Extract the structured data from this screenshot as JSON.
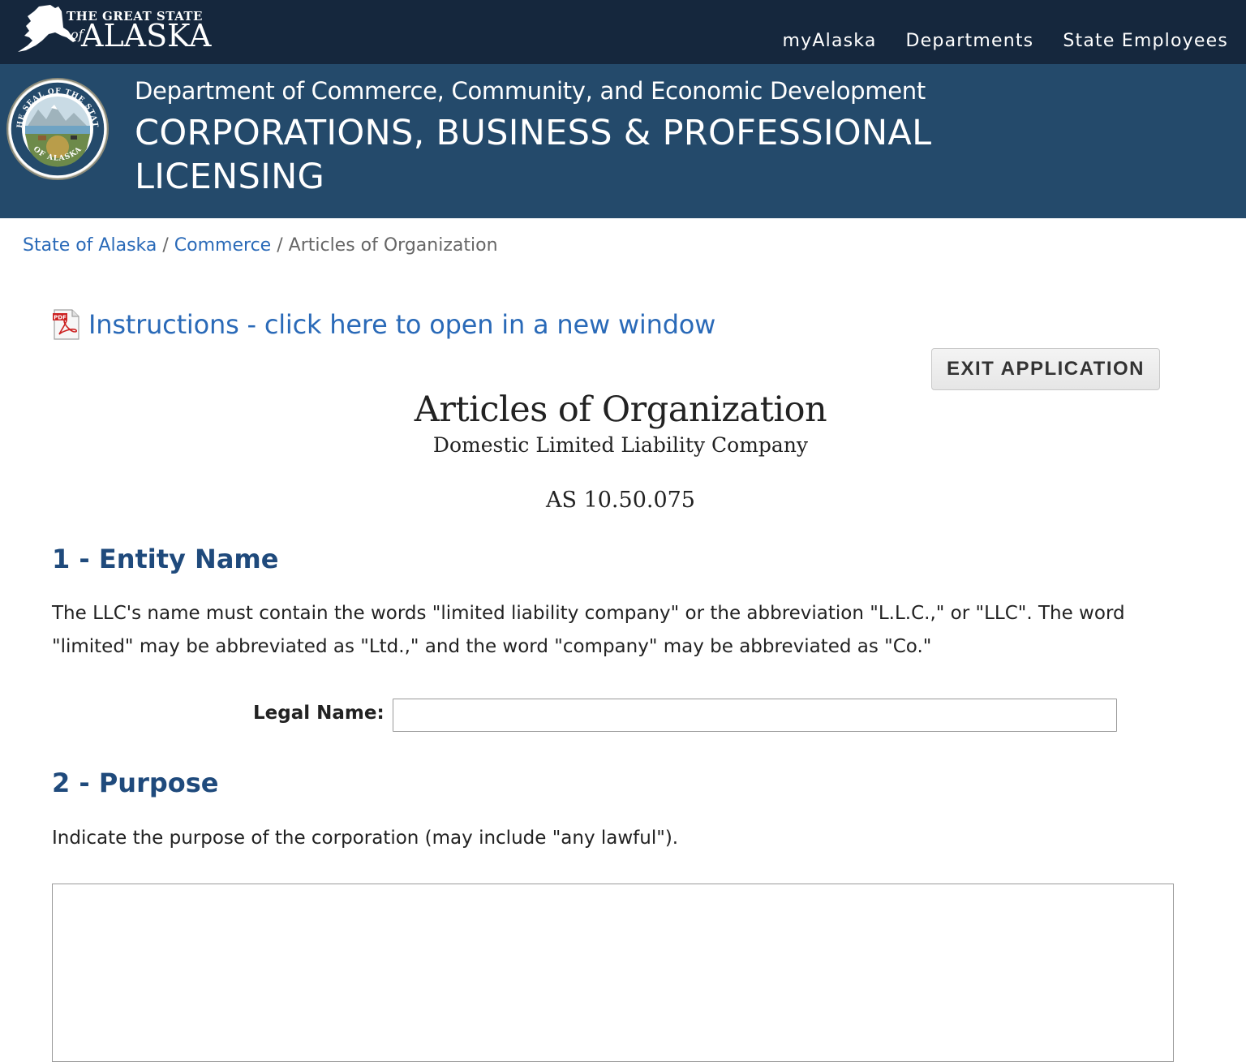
{
  "header": {
    "logo_top": "THE GREAT STATE",
    "logo_of": "of",
    "logo_state": "ALASKA",
    "nav": [
      {
        "label": "myAlaska"
      },
      {
        "label": "Departments"
      },
      {
        "label": "State Employees"
      }
    ]
  },
  "banner": {
    "department": "Department of Commerce, Community, and Economic Development",
    "division": "CORPORATIONS, BUSINESS & PROFESSIONAL LICENSING",
    "seal_text_top": "THE SEAL OF THE STATE",
    "seal_text_bottom": "OF ALASKA"
  },
  "breadcrumb": {
    "items": [
      {
        "label": "State of Alaska"
      },
      {
        "label": "Commerce"
      },
      {
        "label": "Articles of Organization"
      }
    ],
    "separator": "/"
  },
  "instructions": {
    "icon": "pdf-icon",
    "label": "Instructions - click here to open in a new window"
  },
  "exit_button": {
    "label": "EXIT APPLICATION"
  },
  "form": {
    "title": "Articles of Organization",
    "subtitle": "Domestic Limited Liability Company",
    "statute": "AS 10.50.075"
  },
  "sections": [
    {
      "heading": "1 - Entity Name",
      "text": "The LLC's name must contain the words \"limited liability company\" or the abbreviation \"L.L.C.,\" or \"LLC\". The word \"limited\" may be abbreviated as \"Ltd.,\" and the word \"company\" may be abbreviated as \"Co.\"",
      "field_label": "Legal Name:",
      "field_value": "",
      "field_placeholder": ""
    },
    {
      "heading": "2 - Purpose",
      "text": "Indicate the purpose of the corporation (may include \"any lawful\").",
      "field_value": ""
    }
  ],
  "colors": {
    "topbar": "#15273d",
    "banner": "#244a6b",
    "link": "#2a6ab8",
    "heading": "#1f4a7c"
  }
}
